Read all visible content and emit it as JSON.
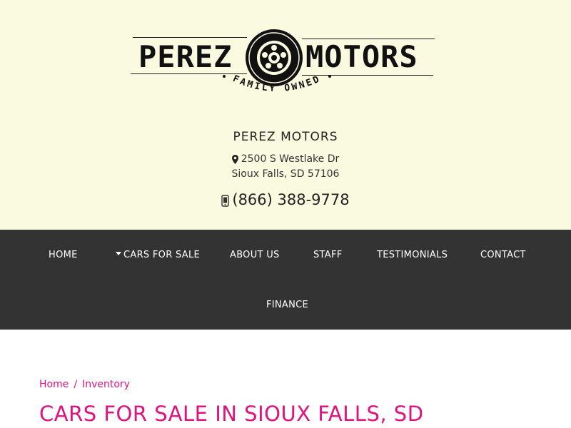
{
  "logo": {
    "word_left": "PEREZ",
    "word_right": "MOTORS",
    "tagline": "FAMILY OWNED"
  },
  "dealer": {
    "name": "PEREZ MOTORS",
    "address_line1": "2500 S Westlake Dr",
    "address_line2": "Sioux Falls, SD 57106",
    "phone": "(866) 388-9778",
    "address_icon": "map-marker-icon",
    "phone_icon": "mobile-phone-icon"
  },
  "nav": {
    "items": [
      {
        "label": "HOME"
      },
      {
        "label": "CARS FOR SALE",
        "has_dropdown": true
      },
      {
        "label": "ABOUT US"
      },
      {
        "label": "STAFF"
      },
      {
        "label": "TESTIMONIALS"
      },
      {
        "label": "CONTACT"
      },
      {
        "label": "FINANCE"
      }
    ]
  },
  "breadcrumb": {
    "items": [
      "Home",
      "Inventory"
    ],
    "separator": "/"
  },
  "page": {
    "title": "CARS FOR SALE IN SIOUX FALLS, SD"
  },
  "colors": {
    "header_bg": "#fafae1",
    "nav_bg": "#333333",
    "accent": "#e0127d"
  }
}
